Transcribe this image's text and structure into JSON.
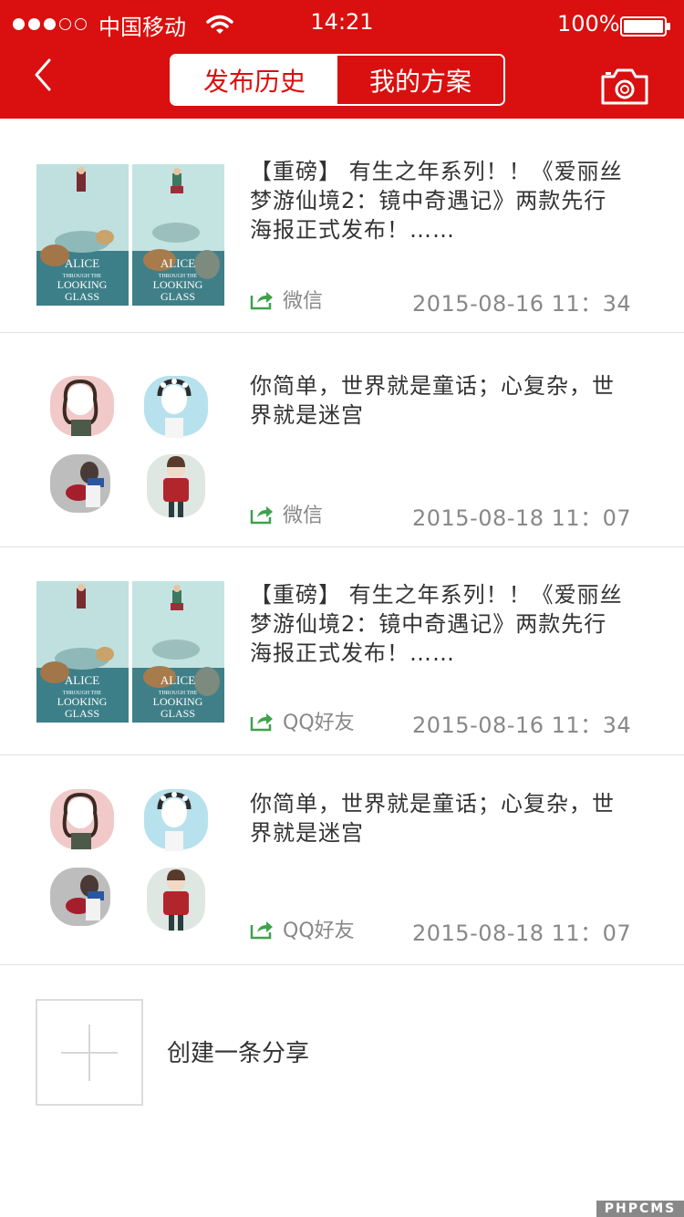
{
  "status_bar": {
    "carrier": "中国移动",
    "time": "14:21",
    "battery": "100%"
  },
  "header": {
    "tabs": [
      {
        "label": "发布历史",
        "active": true
      },
      {
        "label": "我的方案",
        "active": false
      }
    ]
  },
  "items": [
    {
      "title_line1": "【重磅】 有生之年系列！！《爱丽丝",
      "title_line2": "梦游仙境2：镜中奇遇记》两款先行",
      "title_line3": "海报正式发布！……",
      "channel": "微信",
      "date": "2015-08-16 11：34",
      "thumb_type": "posters"
    },
    {
      "title_line1": "你简单，世界就是童话；心复杂，世",
      "title_line2": "界就是迷宫",
      "title_line3": "",
      "channel": "微信",
      "date": "2015-08-18 11：07",
      "thumb_type": "cartoons"
    },
    {
      "title_line1": "【重磅】 有生之年系列！！《爱丽丝",
      "title_line2": "梦游仙境2：镜中奇遇记》两款先行",
      "title_line3": "海报正式发布！……",
      "channel": "QQ好友",
      "date": "2015-08-16 11：34",
      "thumb_type": "posters"
    },
    {
      "title_line1": "你简单，世界就是童话；心复杂，世",
      "title_line2": "界就是迷宫",
      "title_line3": "",
      "channel": "QQ好友",
      "date": "2015-08-18 11：07",
      "thumb_type": "cartoons"
    }
  ],
  "poster_text": {
    "line1": "ALICE",
    "line2": "THROUGH THE",
    "line3": "LOOKING",
    "line4": "GLASS"
  },
  "create": {
    "label": "创建一条分享"
  },
  "watermark": "PHPCMS",
  "colors": {
    "brand_red": "#d9100f",
    "share_green": "#3ea24a",
    "text_gray": "#888888"
  },
  "icons": [
    "back-icon",
    "camera-icon",
    "share-icon",
    "plus-icon",
    "wifi-icon",
    "battery-icon"
  ]
}
